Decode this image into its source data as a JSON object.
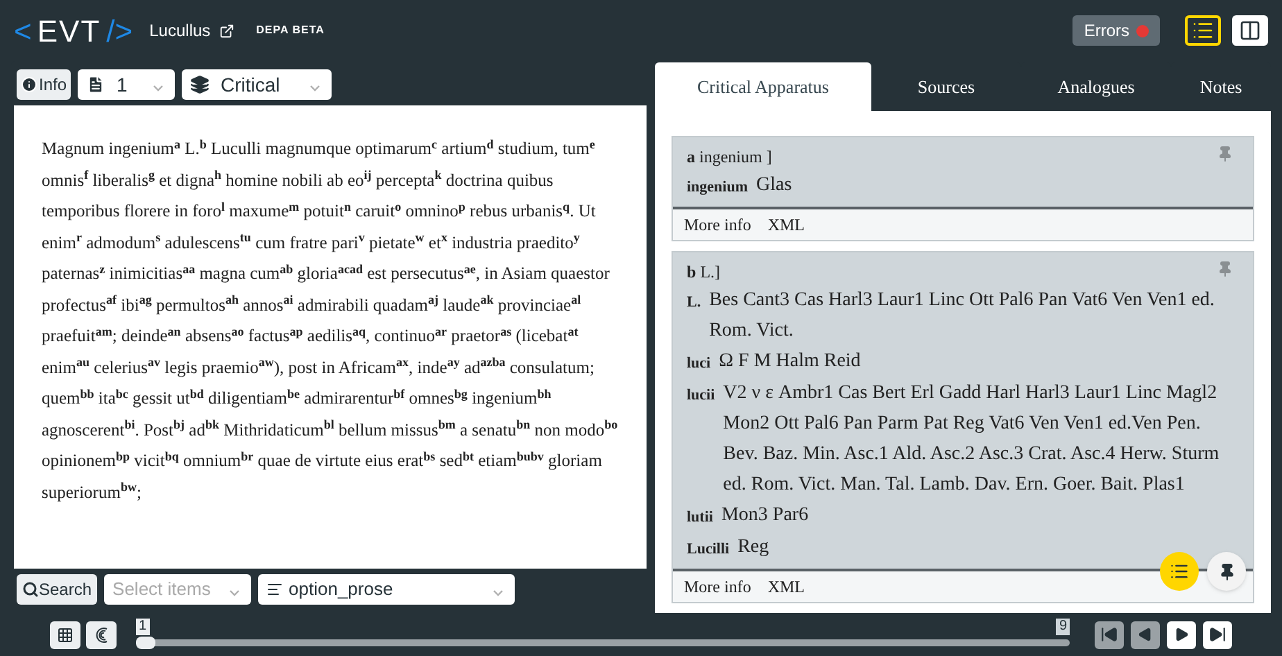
{
  "header": {
    "logo_open": "<",
    "logo": "EVT",
    "logo_close": "/>",
    "title": "Lucullus",
    "badge": "DEPA BETA",
    "errors_button": "Errors",
    "views": [
      {
        "kind": "text",
        "selected": true
      },
      {
        "kind": "split",
        "selected": false
      }
    ]
  },
  "text_panel": {
    "info_button": "Info",
    "page_select": "1",
    "level_select": "Critical",
    "text": "Magnum ingenium$^{a}$ L.$^{b}$ Luculli magnumque optimarum$^{c}$ artium$^{d}$ studium, tum$^{e}$ omnis$^{f}$ liberalis$^{g}$ et digna$^{h}$ homine nobili ab eo$^{ij}$ percepta$^{k}$ doctrina quibus temporibus florere in foro$^{l}$ maxume$^{m}$ potuit$^{n}$ caruit$^{o}$ omnino$^{p}$ rebus urbanis$^{q}$. Ut enim$^{r}$ admodum$^{s}$ adulescens$^{tu}$ cum fratre pari$^{v}$ pietate$^{w}$ et$^{x}$ industria praedito$^{y}$ paternas$^{z}$ inimicitias$^{aa}$ magna cum$^{ab}$ gloria$^{acad}$ est persecutus$^{ae}$, in Asiam quaestor profectus$^{af}$ ibi$^{ag}$ permultos$^{ah}$ annos$^{ai}$ admirabili quadam$^{aj}$ laude$^{ak}$ provinciae$^{al}$ praefuit$^{am}$; deinde$^{an}$ absens$^{ao}$ factus$^{ap}$ aedilis$^{aq}$, continuo$^{ar}$ praetor$^{as}$ (licebat$^{at}$ enim$^{au}$ celerius$^{av}$ legis praemio$^{aw}$), post in Africam$^{ax}$, inde$^{ay}$ ad$^{azba}$ consulatum; quem$^{bb}$ ita$^{bc}$ gessit ut$^{bd}$ diligentiam$^{be}$ admirarentur$^{bf}$ omnes$^{bg}$ ingenium$^{bh}$ agnoscerent$^{bi}$. Post$^{bj}$ ad$^{bk}$ Mithridaticum$^{bl}$ bellum missus$^{bm}$ a senatu$^{bn}$ non modo$^{bo}$ opinionem$^{bp}$ vicit$^{bq}$ omnium$^{br}$ quae de virtute eius erat$^{bs}$ sed$^{bt}$ etiam$^{bubv}$ gloriam superiorum$^{bw}$;",
    "search_button": "Search",
    "filter_select": {
      "placeholder": "Select items"
    },
    "type_select": "option_prose"
  },
  "bottom_bar": {
    "slider": {
      "start_label": "1",
      "end_label": "9",
      "level": 0
    },
    "nav_buttons": [
      {
        "kind": "first",
        "disabled": true
      },
      {
        "kind": "prev",
        "disabled": true
      },
      {
        "kind": "next",
        "disabled": false
      },
      {
        "kind": "last",
        "disabled": false
      }
    ]
  },
  "apparatus_panel": {
    "tabs": [
      {
        "label": "Critical Apparatus",
        "selected": true
      },
      {
        "label": "Sources",
        "selected": false
      },
      {
        "label": "Analogues",
        "selected": false
      },
      {
        "label": "Notes",
        "selected": false
      }
    ],
    "entries": [
      {
        "marker": "a",
        "lemma": "ingenium ]",
        "readings": [
          {
            "label": "ingenium",
            "witnesses": "Glas"
          }
        ],
        "links": [
          "More info",
          "XML"
        ]
      },
      {
        "marker": "b",
        "lemma": "L.]",
        "readings": [
          {
            "label": "L.",
            "witnesses": "Bes Cant3 Cas Harl3 Laur1 Linc Ott Pal6 Pan Vat6 Ven Ven1 ed. Rom. Vict."
          },
          {
            "label": "luci",
            "witnesses": "Ω F M Halm Reid"
          },
          {
            "label": "lucii",
            "witnesses": "V2 ν ε Ambr1 Cas Bert Erl Gadd Harl Harl3 Laur1 Linc Magl2 Mon2 Ott Pal6 Pan Parm Pat Reg Vat6 Ven Ven1 ed.Ven Pen. Bev. Baz. Min. Asc.1 Ald. Asc.2 Asc.3 Crat. Asc.4 Herw. Sturm ed. Rom. Vict. Man. Tal. Lamb. Dav. Ern. Goer. Bait. Plas1"
          },
          {
            "label": "lutii",
            "witnesses": "Mon3 Par6"
          },
          {
            "label": "Lucilli",
            "witnesses": "Reg"
          }
        ],
        "links": [
          "More info",
          "XML"
        ]
      }
    ]
  }
}
